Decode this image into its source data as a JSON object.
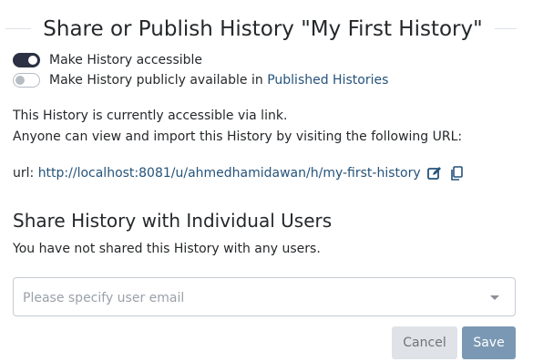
{
  "modal": {
    "title": "Share or Publish History \"My First History\""
  },
  "toggles": {
    "accessible": {
      "label": "Make History accessible",
      "on": true
    },
    "published": {
      "label_prefix": "Make History publicly available in ",
      "link_text": "Published Histories",
      "on": false
    }
  },
  "info": {
    "line1": "This History is currently accessible via link.",
    "line2": "Anyone can view and import this History by visiting the following URL:"
  },
  "url": {
    "label": "url: ",
    "value": "http://localhost:8081/u/ahmedhamidawan/h/my-first-history",
    "edit_icon": "edit-icon",
    "copy_icon": "copy-icon"
  },
  "share": {
    "heading": "Share History with Individual Users",
    "status": "You have not shared this History with any users.",
    "email_placeholder": "Please specify user email"
  },
  "buttons": {
    "cancel": "Cancel",
    "save": "Save"
  },
  "colors": {
    "toggle_on": "#2c3143",
    "link": "#25537b",
    "save_button": "#7a98b3",
    "cancel_button": "#dfe3e7"
  }
}
